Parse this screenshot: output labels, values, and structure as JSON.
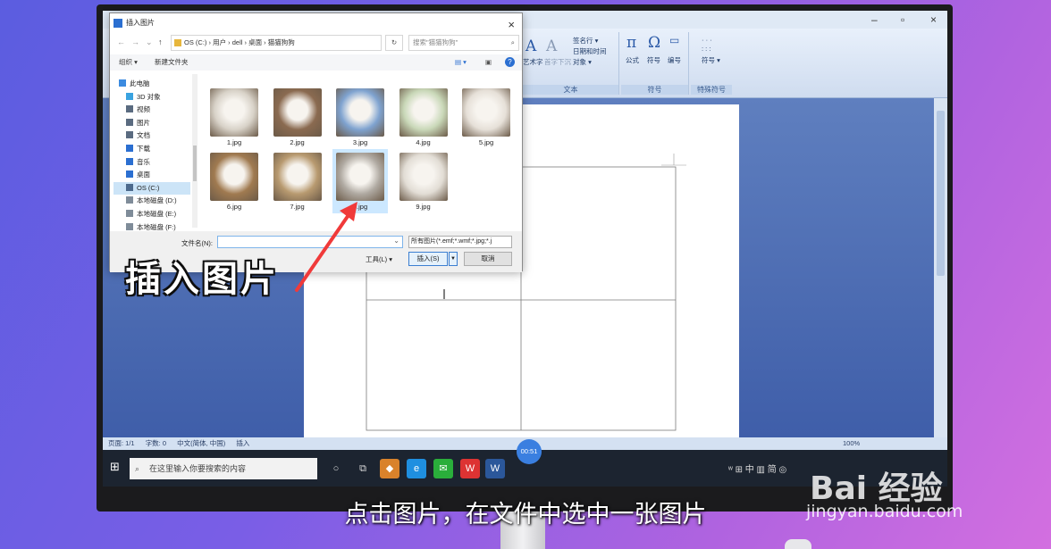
{
  "dialog": {
    "title": "插入图片",
    "close": "×",
    "path_segments": "OS (C:)  ›  用户  ›  dell  ›  桌面  ›  猫猫狗狗",
    "search_placeholder": "搜索\"猫猫狗狗\"",
    "toolbar": {
      "organize": "组织 ▾",
      "new_folder": "新建文件夹"
    },
    "nav": [
      {
        "label": "此电脑",
        "color": "#3c8be0"
      },
      {
        "label": "3D 对象",
        "color": "#3aa3e0"
      },
      {
        "label": "视频",
        "color": "#5a6b80"
      },
      {
        "label": "图片",
        "color": "#5a6b80"
      },
      {
        "label": "文档",
        "color": "#5a6b80"
      },
      {
        "label": "下载",
        "color": "#2b6fd1"
      },
      {
        "label": "音乐",
        "color": "#2b6fd1"
      },
      {
        "label": "桌面",
        "color": "#2b6fd1"
      },
      {
        "label": "OS (C:)",
        "color": "#4d6a8c"
      },
      {
        "label": "本地磁盘 (D:)",
        "color": "#7f8c99"
      },
      {
        "label": "本地磁盘 (E:)",
        "color": "#7f8c99"
      },
      {
        "label": "本地磁盘 (F:)",
        "color": "#7f8c99"
      }
    ],
    "files": [
      {
        "name": "1.jpg",
        "color": "#d8d2c8"
      },
      {
        "name": "2.jpg",
        "color": "#8a6a50"
      },
      {
        "name": "3.jpg",
        "color": "#7fa3d0"
      },
      {
        "name": "4.jpg",
        "color": "#c9d8b8"
      },
      {
        "name": "5.jpg",
        "color": "#e6e0d8"
      },
      {
        "name": "6.jpg",
        "color": "#a07a50"
      },
      {
        "name": "7.jpg",
        "color": "#b89a70"
      },
      {
        "name": "8.jpg",
        "color": "#b0aaa2"
      },
      {
        "name": "9.jpg",
        "color": "#e2ddd5"
      }
    ],
    "filename_label": "文件名(N):",
    "filename_value": "",
    "filetype": "所有图片(*.emf;*.wmf;*.jpg;*.j",
    "tools": "工具(L) ▾",
    "insert": "插入(S)",
    "cancel": "取消"
  },
  "ribbon": {
    "signature": "签名行 ▾",
    "datetime": "日期和时间",
    "object": "对象 ▾",
    "wordart": "艺术字",
    "dropcap": "首字下沉",
    "text_group": "文本",
    "formula": "公式",
    "symbol": "符号",
    "number": "编号",
    "symbol_group": "符号",
    "special_symbol": "符号 ▾",
    "special_group": "特殊符号"
  },
  "status": {
    "page": "页面: 1/1",
    "words": "字数: 0",
    "language": "中文(简体, 中国)",
    "mode": "插入",
    "zoom": "100%"
  },
  "timer": "00:51",
  "taskbar": {
    "search_placeholder": "在这里输入你要搜索的内容",
    "tray": "ʷ ⊞ 中 ▥ 简 ◎"
  },
  "overlay": {
    "caption": "插入图片",
    "subtitle": "点击图片，在文件中选中一张图片",
    "watermark_logo": "Bai 经验",
    "watermark_url": "jingyan.baidu.com"
  }
}
